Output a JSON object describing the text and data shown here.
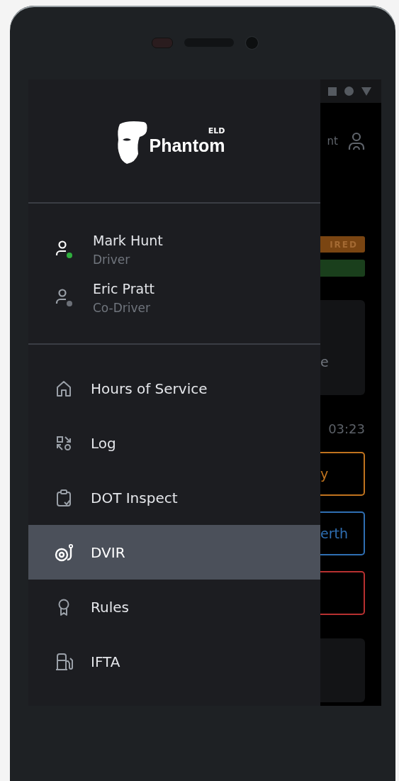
{
  "drawer": {
    "brand": {
      "name": "Phantom",
      "tag": "ELD"
    },
    "users": [
      {
        "name": "Mark Hunt",
        "role": "Driver",
        "online": true
      },
      {
        "name": "Eric Pratt",
        "role": "Co-Driver",
        "online": false
      }
    ],
    "menu": [
      {
        "label": "Hours of Service",
        "kind": "home",
        "selected": false
      },
      {
        "label": "Log",
        "kind": "log",
        "selected": false
      },
      {
        "label": "DOT Inspect",
        "kind": "clipboard",
        "selected": false
      },
      {
        "label": "DVIR",
        "kind": "reel",
        "selected": true
      },
      {
        "label": "Rules",
        "kind": "award",
        "selected": false
      },
      {
        "label": "IFTA",
        "kind": "fuel",
        "selected": false
      }
    ]
  },
  "background_screen": {
    "header_text": "nt",
    "badge": "IRED",
    "card_text": "e",
    "clock": "03:23",
    "buttons": [
      {
        "label": "y",
        "color": "#c0731e"
      },
      {
        "label": "erth",
        "color": "#2f6fb3"
      },
      {
        "color": "#b73030"
      }
    ]
  }
}
